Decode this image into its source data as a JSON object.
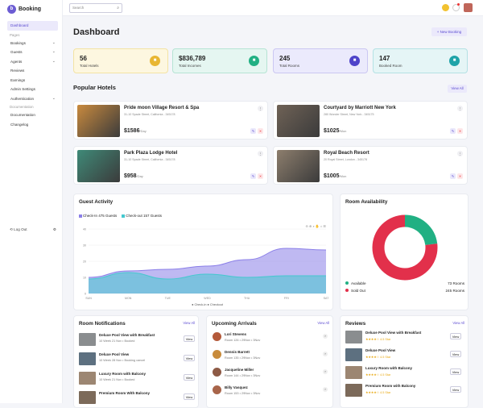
{
  "brand": {
    "name": "Booking",
    "logo": "b"
  },
  "sidebar": {
    "items": [
      {
        "label": "Dashboard",
        "type": "item",
        "active": true
      },
      {
        "label": "Pages",
        "type": "section"
      },
      {
        "label": "Bookings",
        "type": "item",
        "chev": "⌄"
      },
      {
        "label": "Guests",
        "type": "item",
        "chev": "⌄"
      },
      {
        "label": "Agents",
        "type": "item",
        "chev": "⌄"
      },
      {
        "label": "Reviews",
        "type": "item"
      },
      {
        "label": "Earnings",
        "type": "item"
      },
      {
        "label": "Admin Settings",
        "type": "item"
      },
      {
        "label": "Authentication",
        "type": "item",
        "chev": "⌄"
      },
      {
        "label": "Documentation",
        "type": "section"
      },
      {
        "label": "Documentation",
        "type": "item"
      },
      {
        "label": "Changelog",
        "type": "item"
      }
    ],
    "logout": "Log Out",
    "settings_icon": "gear-icon"
  },
  "topbar": {
    "search_placeholder": "Search",
    "search_icon": "search-icon"
  },
  "header": {
    "title": "Dashboard",
    "new_booking": "+ New Booking"
  },
  "stats": [
    {
      "value": "56",
      "label": "Total Hotels",
      "bg": "#fdf7e0",
      "border": "#f3e3a4",
      "icon_bg": "#e8b632",
      "icon": "hotel-icon"
    },
    {
      "value": "$836,789",
      "label": "Total Incomes",
      "bg": "#e5f6f1",
      "border": "#b6e4d4",
      "icon_bg": "#21b083",
      "icon": "income-icon"
    },
    {
      "value": "245",
      "label": "Total Rooms",
      "bg": "#ebeafc",
      "border": "#cbc7f2",
      "icon_bg": "#4e43c9",
      "icon": "bed-icon"
    },
    {
      "value": "147",
      "label": "Booked Room",
      "bg": "#e5f5f6",
      "border": "#b4e1e4",
      "icon_bg": "#1fa3a8",
      "icon": "booked-icon"
    }
  ],
  "popular": {
    "title": "Popular Hotels",
    "view_all": "View All",
    "hotels": [
      {
        "name": "Pride moon Village Resort & Spa",
        "address": "31-10 Spade Street, California - 345178",
        "price": "$1586",
        "per": "/Day",
        "color": "#c98a3e"
      },
      {
        "name": "Courtyard by Marriott New York",
        "address": "280 Wonder Street, New York - 345175",
        "price": "$1025",
        "per": "/Mon",
        "color": "#6f6256"
      },
      {
        "name": "Park Plaza Lodge Hotel",
        "address": "31-10 Spade Street, California - 345178",
        "price": "$958",
        "per": "/Day",
        "color": "#3f8a78"
      },
      {
        "name": "Royal Beach Resort",
        "address": "20 Royal Street, London - 345178",
        "price": "$1005",
        "per": "/Mon",
        "color": "#8d7e6d"
      }
    ]
  },
  "guest_activity": {
    "title": "Guest Activity",
    "checkin": "Check-In 475 Guests",
    "checkout": "Check-out 157 Guests",
    "legend_in": "Check-in",
    "legend_out": "Checkout"
  },
  "chart_data": {
    "type": "area",
    "categories": [
      "SUN",
      "MON",
      "TUE",
      "WED",
      "THU",
      "FRI",
      "SAT"
    ],
    "series": [
      {
        "name": "Check-in",
        "values": [
          10,
          14,
          15,
          17,
          21,
          28,
          27
        ],
        "color": "#8b7fe8"
      },
      {
        "name": "Checkout",
        "values": [
          9,
          13,
          9,
          12,
          10,
          11,
          11
        ],
        "color": "#45c8cf"
      }
    ],
    "yticks": [
      "0",
      "10",
      "20",
      "30",
      "40"
    ],
    "ylim": [
      0,
      40
    ]
  },
  "room_availability": {
    "title": "Room Availability",
    "available_label": "Available",
    "available_value": "73 Rooms",
    "soldout_label": "Sold Out",
    "soldout_value": "245 Rooms",
    "available_color": "#21b083",
    "soldout_color": "#e2304b",
    "available": 73,
    "soldout": 245
  },
  "notifications": {
    "title": "Room Notifications",
    "view_all": "View All",
    "items": [
      {
        "title": "Deluxe Pool View with Breakfast",
        "sub": "10 Week 21 Nov  •  Booked",
        "btn": "View",
        "color": "#8a8d8f"
      },
      {
        "title": "Deluxe Pool View",
        "sub": "10 Week 28 Nov  •  Booking cancel",
        "btn": "View",
        "color": "#5d7080"
      },
      {
        "title": "Luxury Room with Balcony",
        "sub": "10 Week 21 Nov  •  Booked",
        "btn": "View",
        "color": "#9c8672"
      },
      {
        "title": "Premium Room With Balcony",
        "sub": "",
        "btn": "View",
        "color": "#7c6a5a"
      }
    ]
  },
  "arrivals": {
    "title": "Upcoming Arrivals",
    "view_all": "View All",
    "items": [
      {
        "name": "Lori Stevens",
        "sub": "Room 126  •  29Nov  •  3Nov",
        "color": "#b45a3a"
      },
      {
        "name": "Dennis Barrett",
        "sub": "Room 135  •  29Nov  •  3Nov",
        "color": "#c88b3b"
      },
      {
        "name": "Jacqueline Miller",
        "sub": "Room 144  •  29Nov  •  3Nov",
        "color": "#8d5a45"
      },
      {
        "name": "Billy Vasquez",
        "sub": "Room 153  •  29Nov  •  3Nov",
        "color": "#a8654a"
      }
    ]
  },
  "reviews": {
    "title": "Reviews",
    "view_all": "View All",
    "items": [
      {
        "title": "Deluxe Pool View with Breakfast",
        "stars": "★★★★☆ 4.5 Star",
        "btn": "View",
        "color": "#8a8d8f"
      },
      {
        "title": "Deluxe Pool View",
        "stars": "★★★★☆ 4.5 Star",
        "btn": "View",
        "color": "#5d7080"
      },
      {
        "title": "Luxury Room with Balcony",
        "stars": "★★★★☆ 4.5 Star",
        "btn": "View",
        "color": "#9c8672"
      },
      {
        "title": "Premium Room with Balcony",
        "stars": "★★★★☆ 4.5 Star",
        "btn": "View",
        "color": "#7c6a5a"
      }
    ]
  }
}
